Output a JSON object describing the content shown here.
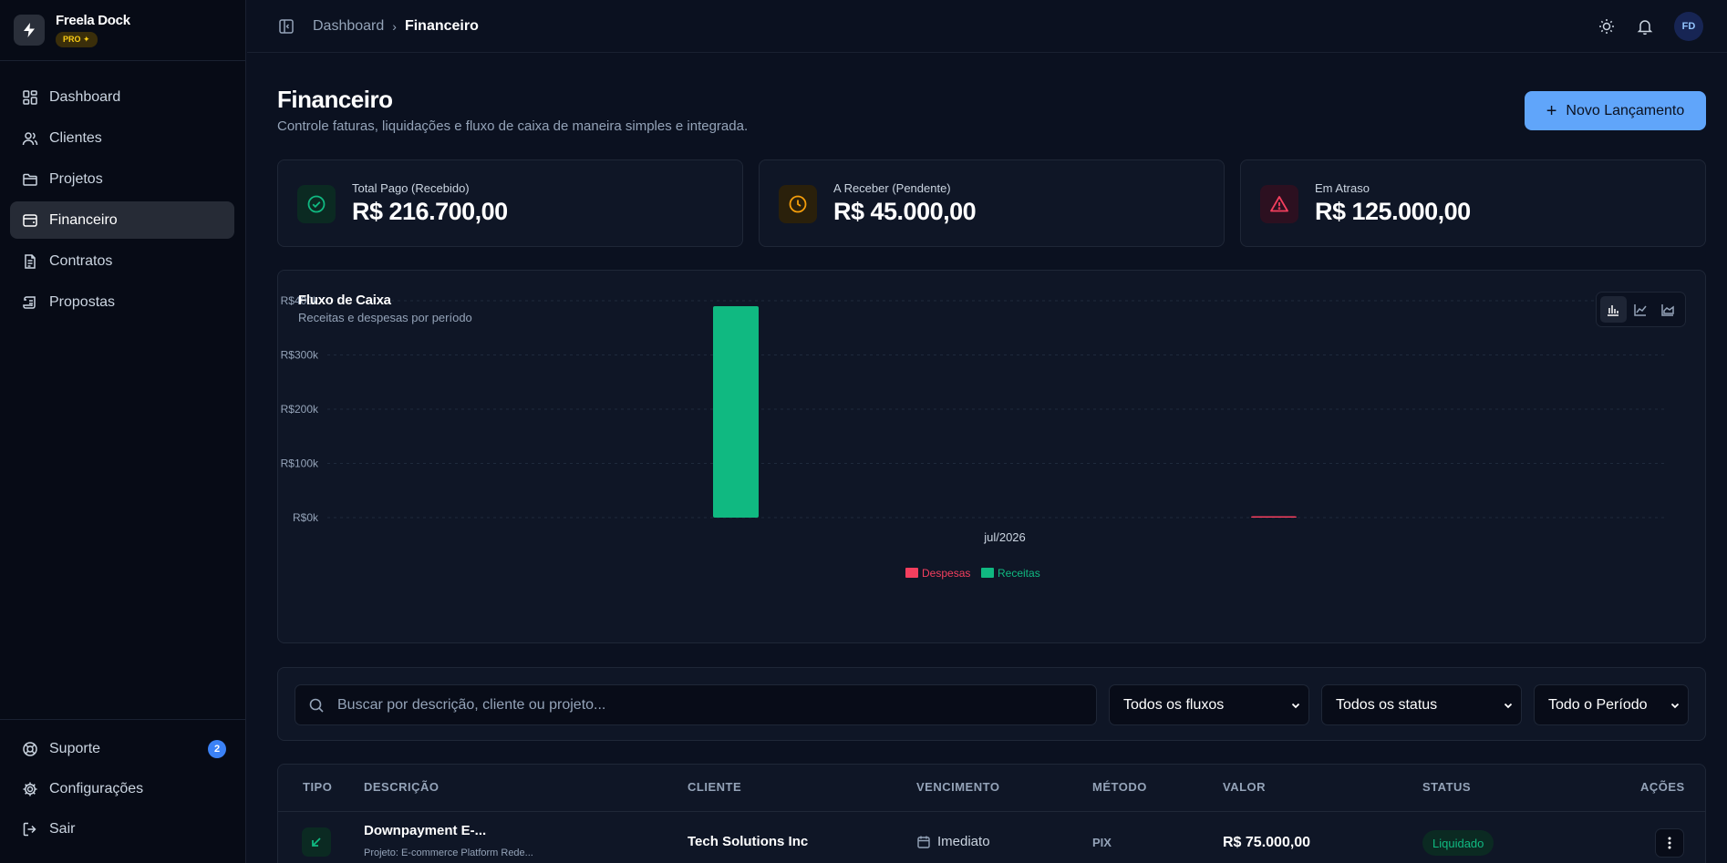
{
  "app": {
    "name": "Freela Dock",
    "plan_badge": "PRO ✦"
  },
  "sidebar": {
    "items": [
      {
        "label": "Dashboard",
        "icon": "dashboard-icon"
      },
      {
        "label": "Clientes",
        "icon": "users-icon"
      },
      {
        "label": "Projetos",
        "icon": "folder-icon"
      },
      {
        "label": "Financeiro",
        "icon": "wallet-icon",
        "active": true
      },
      {
        "label": "Contratos",
        "icon": "document-icon"
      },
      {
        "label": "Propostas",
        "icon": "scroll-icon"
      }
    ],
    "footer": [
      {
        "label": "Suporte",
        "icon": "lifebuoy-icon",
        "badge": "2"
      },
      {
        "label": "Configurações",
        "icon": "gear-icon"
      },
      {
        "label": "Sair",
        "icon": "logout-icon"
      }
    ]
  },
  "topbar": {
    "breadcrumb": [
      "Dashboard",
      "Financeiro"
    ],
    "avatar_initials": "FD"
  },
  "page": {
    "title": "Financeiro",
    "subtitle": "Controle faturas, liquidações e fluxo de caixa de maneira simples e integrada.",
    "primary_action": "Novo Lançamento"
  },
  "stats": [
    {
      "label": "Total Pago (Recebido)",
      "value": "R$ 216.700,00",
      "color": "#10b981",
      "icon": "check-circle-icon"
    },
    {
      "label": "A Receber (Pendente)",
      "value": "R$ 45.000,00",
      "color": "#f59e0b",
      "icon": "clock-icon"
    },
    {
      "label": "Em Atraso",
      "value": "R$ 125.000,00",
      "color": "#f43f5e",
      "icon": "alert-triangle-icon"
    }
  ],
  "cashflow": {
    "title": "Fluxo de Caixa",
    "subtitle": "Receitas e despesas por período",
    "view_modes": [
      "bar-chart-icon",
      "line-chart-icon",
      "area-chart-icon"
    ],
    "active_view": "bar-chart-icon"
  },
  "chart_data": {
    "type": "bar",
    "categories": [
      "jul/2026"
    ],
    "series": [
      {
        "name": "Receitas",
        "values": [
          390000
        ],
        "color": "#10b981"
      },
      {
        "name": "Despesas",
        "values": [
          1500
        ],
        "color": "#f43f5e"
      }
    ],
    "y_ticks": [
      "R$0k",
      "R$100k",
      "R$200k",
      "R$300k",
      "R$400k"
    ],
    "ylim": [
      0,
      400000
    ],
    "grid": true,
    "legend_position": "bottom-center",
    "legend_order": [
      "Despesas",
      "Receitas"
    ]
  },
  "filters": {
    "search_placeholder": "Buscar por descrição, cliente ou projeto...",
    "flow": "Todos os fluxos",
    "status": "Todos os status",
    "period": "Todo o Período"
  },
  "table": {
    "columns": [
      "TIPO",
      "DESCRIÇÃO",
      "CLIENTE",
      "VENCIMENTO",
      "MÉTODO",
      "VALOR",
      "STATUS",
      "AÇÕES"
    ],
    "rows": [
      {
        "type_icon": "arrow-down-left-icon",
        "description": "Downpayment E-...",
        "project": "Projeto: E-commerce Platform Rede...",
        "client": "Tech Solutions Inc",
        "due": "Imediato",
        "method": "PIX",
        "amount": "R$ 75.000,00",
        "status": "Liquidado"
      }
    ]
  }
}
